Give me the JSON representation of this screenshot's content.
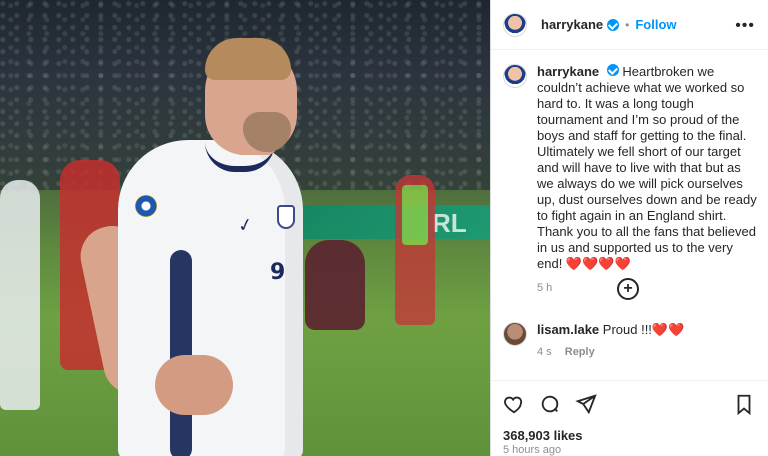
{
  "photo": {
    "board_text": "RL",
    "shirt_number": "9"
  },
  "post": {
    "header": {
      "username": "harrykane",
      "follow_label": "Follow",
      "separator": "•",
      "more_label": "•••"
    },
    "caption": {
      "username": "harrykane",
      "text": "Heartbroken we couldn’t achieve what we worked so hard to. It was a long tough tournament and I’m so proud of the boys and staff for getting to the final. Ultimately we fell short of our target and will have to live with that but as we always do we will pick ourselves up, dust ourselves down and be ready to fight again in an England shirt. Thank you to all the fans that believed in us and supported us to the very end! ❤️❤️❤️❤️",
      "time": "5 h"
    },
    "more_comments_icon": "plus-circle-icon",
    "comment": {
      "username": "lisam.lake",
      "text": "Proud !!!❤️❤️",
      "time": "4 s",
      "reply_label": "Reply"
    },
    "footer": {
      "likes": "368,903 likes",
      "posted_time": "5 hours ago"
    }
  },
  "colors": {
    "accent": "#0095f6",
    "text": "#262626",
    "muted": "#8e8e8e",
    "border": "#dbdbdb"
  }
}
